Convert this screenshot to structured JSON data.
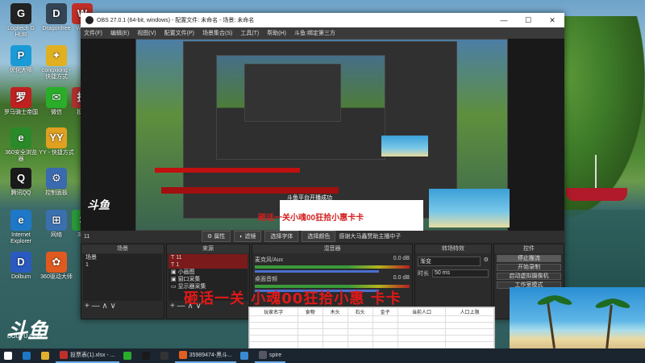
{
  "desktop": {
    "icons": [
      {
        "label": "Logitech G HUB",
        "glyph": "G",
        "color": "#222222"
      },
      {
        "label": "Dragonfree",
        "glyph": "D",
        "color": "#334455"
      },
      {
        "label": "WPS",
        "glyph": "W",
        "color": "#c0302a"
      },
      {
        "label": "优化大师",
        "glyph": "P",
        "color": "#1a9ad6"
      },
      {
        "label": "congxiong - 快捷方式",
        "glyph": "✦",
        "color": "#e0b020"
      },
      {
        "label": "罗马骑士帝国",
        "glyph": "罗",
        "color": "#c02020"
      },
      {
        "label": "微信",
        "glyph": "✉",
        "color": "#2aae2a"
      },
      {
        "label": "投屏",
        "glyph": "投",
        "color": "#b03030"
      },
      {
        "label": "360安全浏览器",
        "glyph": "e",
        "color": "#2a8a2a"
      },
      {
        "label": "YY - 快捷方式",
        "glyph": "YY",
        "color": "#e0a020"
      },
      {
        "label": "腾讯QQ",
        "glyph": "Q",
        "color": "#1a1a1a"
      },
      {
        "label": "控制面板",
        "glyph": "⚙",
        "color": "#3a6ab0"
      },
      {
        "label": "Internet Explorer",
        "glyph": "e",
        "color": "#1e78c8"
      },
      {
        "label": "网络",
        "glyph": "⊞",
        "color": "#3a70b0"
      },
      {
        "label": "360",
        "glyph": "3",
        "color": "#2a9a3a"
      },
      {
        "label": "Dolbum",
        "glyph": "D",
        "color": "#2a5ac0"
      },
      {
        "label": "360驱动大师",
        "glyph": "✿",
        "color": "#e05a20"
      }
    ]
  },
  "obs": {
    "title": "OBS 27.0.1 (64-bit, windows) - 配置文件: 未命名 - 场景: 未命名",
    "menu": [
      "文件(F)",
      "编辑(E)",
      "视图(V)",
      "配置文件(P)",
      "场景集合(S)",
      "工具(T)",
      "帮助(H)",
      "斗鱼:绑定第三方"
    ],
    "window_buttons": [
      "—",
      "☐",
      "✕"
    ],
    "toolbar": {
      "source_name": "11",
      "properties": "属性",
      "filters": "滤镜",
      "select_window": "选择字体",
      "select_color": "选择颜色",
      "text_content": "感谢大马鑫赞助主播中子"
    },
    "scenes": {
      "title": "场景",
      "items": [
        "场景",
        "1"
      ]
    },
    "sources": {
      "title": "来源",
      "items": [
        "11",
        "1",
        "小画图",
        "窗口采集",
        "显示器采集"
      ],
      "selected": 0
    },
    "mixer": {
      "title": "混音器",
      "channels": [
        {
          "name": "麦克风/Aux",
          "db": "0.0 dB"
        },
        {
          "name": "桌面音频",
          "db": "0.0 dB"
        }
      ]
    },
    "transitions": {
      "title": "转场特效",
      "type": "渐变",
      "duration_label": "时长",
      "duration_value": "50 ms"
    },
    "controls": {
      "title": "控件",
      "buttons": [
        "停止推流",
        "开始录制",
        "启动虚拟摄像机",
        "工作室模式"
      ]
    },
    "preview": {
      "overlay_message": "斗鱼平台开播成功",
      "nested_red_text": "砸话一关小魂00狂拾小惠卡卡"
    },
    "foot_controls": "+ — ∧ ∨"
  },
  "danmaku": "砸话一关 小魂00狂拾小惠 卡卡",
  "stats_table": {
    "headers": [
      "玩家名字",
      "食物",
      "木头",
      "石头",
      "金子",
      "当前人口",
      "人口上限"
    ],
    "rows": 5
  },
  "douyu": {
    "logo": "斗鱼",
    "sub": "DOUYU.COM",
    "room_id": "9418991"
  },
  "taskbar": {
    "items": [
      {
        "label": "",
        "icon": "windows-icon"
      },
      {
        "label": "",
        "icon": "ie-icon"
      },
      {
        "label": "",
        "icon": "folder-icon"
      },
      {
        "label": "投票表(1).xlsx - ...",
        "icon": "wps-icon"
      },
      {
        "label": "",
        "icon": "wechat-icon"
      },
      {
        "label": "",
        "icon": "qq-icon"
      },
      {
        "label": "",
        "icon": "obs-icon"
      },
      {
        "label": "35989474-黑斗...",
        "icon": "douyu-icon"
      },
      {
        "label": "",
        "icon": "app-icon"
      },
      {
        "label": "spire",
        "icon": "spire-icon"
      }
    ]
  }
}
